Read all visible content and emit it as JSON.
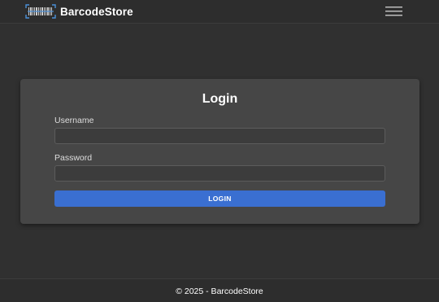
{
  "navbar": {
    "brand_name": "BarcodeStore",
    "brand_icon": "barcode-icon",
    "menu_icon": "hamburger-menu-icon"
  },
  "login_card": {
    "title": "Login",
    "username_label": "Username",
    "username_value": "",
    "password_label": "Password",
    "password_value": "",
    "submit_label": "LOGIN"
  },
  "footer": {
    "text": "© 2025 - BarcodeStore"
  },
  "colors": {
    "background": "#303030",
    "navbar": "#2d2d2d",
    "card": "#464646",
    "input": "#3c3c3c",
    "primary_button": "#3a6fd1",
    "brand_icon_accent": "#4a8fd8"
  }
}
